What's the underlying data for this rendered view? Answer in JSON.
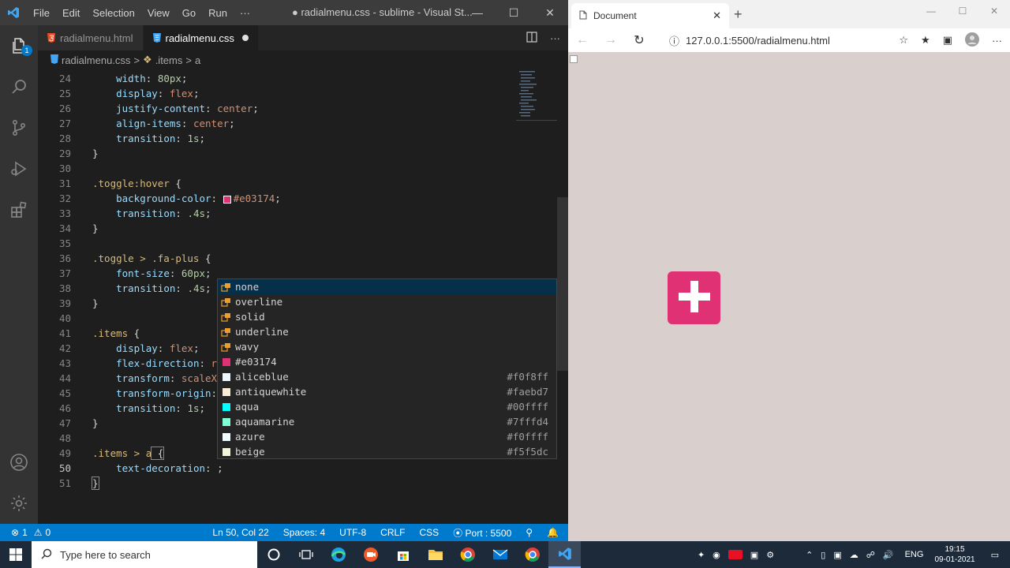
{
  "vscode": {
    "menu": [
      "File",
      "Edit",
      "Selection",
      "View",
      "Go",
      "Run",
      "···"
    ],
    "window_title": "● radialmenu.css - sublime - Visual St...",
    "tabs": [
      {
        "label": "radialmenu.html",
        "active": false
      },
      {
        "label": "radialmenu.css",
        "active": true,
        "modified": true
      }
    ],
    "explorer_badge": "1",
    "breadcrumb": {
      "file": "radialmenu.css",
      "sep": ">",
      "symbol": ".items",
      "sep2": ">",
      "leaf": "a"
    },
    "code_lines": [
      {
        "n": "24",
        "indent": "    ",
        "prop": "width",
        "val": "80px",
        "type": "num"
      },
      {
        "n": "25",
        "indent": "    ",
        "prop": "display",
        "val": "flex",
        "type": "kw"
      },
      {
        "n": "26",
        "indent": "    ",
        "prop": "justify-content",
        "val": "center",
        "type": "kw"
      },
      {
        "n": "27",
        "indent": "    ",
        "prop": "align-items",
        "val": "center",
        "type": "kw"
      },
      {
        "n": "28",
        "indent": "    ",
        "prop": "transition",
        "val": "1s",
        "type": "num"
      },
      {
        "n": "29",
        "text": "}"
      },
      {
        "n": "30",
        "text": ""
      },
      {
        "n": "31",
        "selector": ".toggle:hover",
        "open": " {"
      },
      {
        "n": "32",
        "indent": "    ",
        "prop": "background-color",
        "val": "#e03174",
        "type": "color",
        "swatch": "#e03174"
      },
      {
        "n": "33",
        "indent": "    ",
        "prop": "transition",
        "val": ".4s",
        "type": "num"
      },
      {
        "n": "34",
        "text": "}"
      },
      {
        "n": "35",
        "text": ""
      },
      {
        "n": "36",
        "selector": ".toggle > .fa-plus",
        "open": " {"
      },
      {
        "n": "37",
        "indent": "    ",
        "prop": "font-size",
        "val": "60px",
        "type": "num"
      },
      {
        "n": "38",
        "indent": "    ",
        "prop": "transition",
        "val": ".4s",
        "type": "num"
      },
      {
        "n": "39",
        "text": "}"
      },
      {
        "n": "40",
        "text": ""
      },
      {
        "n": "41",
        "selector": ".items",
        "open": " {"
      },
      {
        "n": "42",
        "indent": "    ",
        "prop": "display",
        "val": "flex",
        "type": "kw"
      },
      {
        "n": "43",
        "indent": "    ",
        "prop": "flex-direction",
        "val": "r",
        "type": "kw",
        "partial": true
      },
      {
        "n": "44",
        "indent": "    ",
        "prop": "transform",
        "val": "scaleX",
        "type": "kw",
        "partial": true
      },
      {
        "n": "45",
        "indent": "    ",
        "prop": "transform-origin",
        "val": "",
        "type": "kw",
        "partial": true
      },
      {
        "n": "46",
        "indent": "    ",
        "prop": "transition",
        "val": "1s",
        "type": "num"
      },
      {
        "n": "47",
        "text": "}"
      },
      {
        "n": "48",
        "text": ""
      },
      {
        "n": "49",
        "selector": ".items > a",
        "open": " {"
      },
      {
        "n": "50",
        "indent": "    ",
        "prop": "text-decoration",
        "val": "",
        "type": "kw",
        "current": true
      },
      {
        "n": "51",
        "text": "}"
      }
    ],
    "suggestions": [
      {
        "label": "none",
        "kind": "value",
        "selected": true
      },
      {
        "label": "overline",
        "kind": "value"
      },
      {
        "label": "solid",
        "kind": "value"
      },
      {
        "label": "underline",
        "kind": "value"
      },
      {
        "label": "wavy",
        "kind": "value"
      },
      {
        "label": "#e03174",
        "kind": "color",
        "color": "#e03174"
      },
      {
        "label": "aliceblue",
        "kind": "color",
        "color": "#f0f8ff",
        "hex": "#f0f8ff"
      },
      {
        "label": "antiquewhite",
        "kind": "color",
        "color": "#faebd7",
        "hex": "#faebd7"
      },
      {
        "label": "aqua",
        "kind": "color",
        "color": "#00ffff",
        "hex": "#00ffff"
      },
      {
        "label": "aquamarine",
        "kind": "color",
        "color": "#7fffd4",
        "hex": "#7fffd4"
      },
      {
        "label": "azure",
        "kind": "color",
        "color": "#f0ffff",
        "hex": "#f0ffff"
      },
      {
        "label": "beige",
        "kind": "color",
        "color": "#f5f5dc",
        "hex": "#f5f5dc"
      }
    ],
    "status": {
      "errors": "1",
      "warnings": "0",
      "position": "Ln 50, Col 22",
      "spaces": "Spaces: 4",
      "encoding": "UTF-8",
      "eol": "CRLF",
      "language": "CSS",
      "port": "Port : 5500"
    }
  },
  "browser": {
    "tab_title": "Document",
    "url": "127.0.0.1:5500/radialmenu.html",
    "toggle_color": "#e03174",
    "page_bg": "#d9cfcd"
  },
  "taskbar": {
    "search_placeholder": "Type here to search",
    "lang": "ENG",
    "time": "19:15",
    "date": "09-01-2021"
  },
  "colors": {
    "accent": "#007acc",
    "pink": "#e03174"
  }
}
